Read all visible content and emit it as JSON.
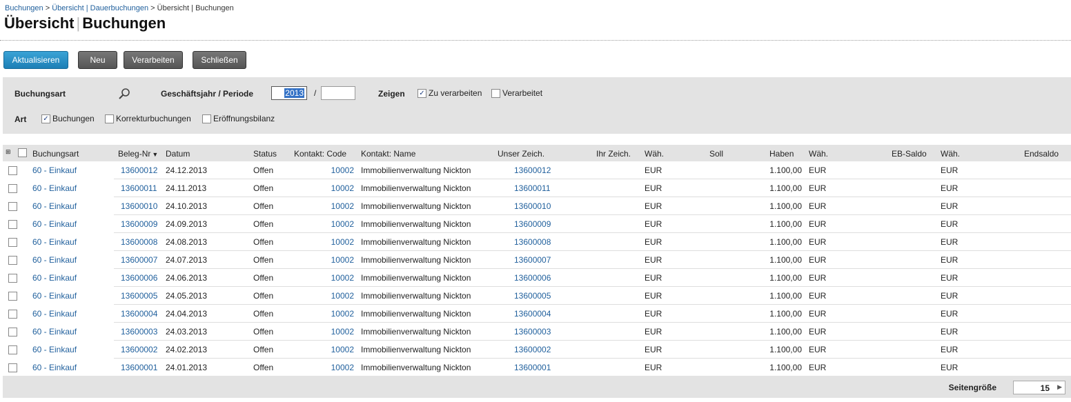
{
  "breadcrumb": {
    "items": [
      "Buchungen",
      "Übersicht | Dauerbuchungen",
      "Übersicht | Buchungen"
    ],
    "sep": ">"
  },
  "page": {
    "title_a": "Übersicht",
    "title_b": "Buchungen"
  },
  "toolbar": {
    "refresh": "Aktualisieren",
    "new": "Neu",
    "process": "Verarbeiten",
    "close": "Schließen"
  },
  "filter": {
    "booking_type_label": "Buchungsart",
    "fiscal_label": "Geschäftsjahr / Periode",
    "year_value": "2013",
    "period_value": "",
    "slash": "/",
    "show_label": "Zeigen",
    "to_process_label": "Zu verarbeiten",
    "to_process_checked": true,
    "processed_label": "Verarbeitet",
    "processed_checked": false,
    "art_label": "Art",
    "bookings_label": "Buchungen",
    "bookings_checked": true,
    "corrections_label": "Korrekturbuchungen",
    "corrections_checked": false,
    "opening_label": "Eröffnungsbilanz",
    "opening_checked": false
  },
  "grid": {
    "columns": {
      "type": "Buchungsart",
      "number": "Beleg-Nr",
      "date": "Datum",
      "status": "Status",
      "contact_code": "Kontakt: Code",
      "contact_name": "Kontakt: Name",
      "our_ref": "Unser Zeich.",
      "their_ref": "Ihr Zeich.",
      "currency1": "Wäh.",
      "debit": "Soll",
      "credit": "Haben",
      "currency2": "Wäh.",
      "eb_balance": "EB-Saldo",
      "currency3": "Wäh.",
      "end_balance": "Endsaldo"
    },
    "rows": [
      {
        "type": "60 - Einkauf",
        "number": "13600012",
        "date": "24.12.2013",
        "status": "Offen",
        "code": "10002",
        "name": "Immobilienverwaltung Nickton",
        "our_ref": "13600012",
        "their_ref": "",
        "cur1": "EUR",
        "debit": "",
        "credit": "1.100,00",
        "cur2": "EUR",
        "eb": "",
        "cur3": "EUR",
        "end": ""
      },
      {
        "type": "60 - Einkauf",
        "number": "13600011",
        "date": "24.11.2013",
        "status": "Offen",
        "code": "10002",
        "name": "Immobilienverwaltung Nickton",
        "our_ref": "13600011",
        "their_ref": "",
        "cur1": "EUR",
        "debit": "",
        "credit": "1.100,00",
        "cur2": "EUR",
        "eb": "",
        "cur3": "EUR",
        "end": ""
      },
      {
        "type": "60 - Einkauf",
        "number": "13600010",
        "date": "24.10.2013",
        "status": "Offen",
        "code": "10002",
        "name": "Immobilienverwaltung Nickton",
        "our_ref": "13600010",
        "their_ref": "",
        "cur1": "EUR",
        "debit": "",
        "credit": "1.100,00",
        "cur2": "EUR",
        "eb": "",
        "cur3": "EUR",
        "end": ""
      },
      {
        "type": "60 - Einkauf",
        "number": "13600009",
        "date": "24.09.2013",
        "status": "Offen",
        "code": "10002",
        "name": "Immobilienverwaltung Nickton",
        "our_ref": "13600009",
        "their_ref": "",
        "cur1": "EUR",
        "debit": "",
        "credit": "1.100,00",
        "cur2": "EUR",
        "eb": "",
        "cur3": "EUR",
        "end": ""
      },
      {
        "type": "60 - Einkauf",
        "number": "13600008",
        "date": "24.08.2013",
        "status": "Offen",
        "code": "10002",
        "name": "Immobilienverwaltung Nickton",
        "our_ref": "13600008",
        "their_ref": "",
        "cur1": "EUR",
        "debit": "",
        "credit": "1.100,00",
        "cur2": "EUR",
        "eb": "",
        "cur3": "EUR",
        "end": ""
      },
      {
        "type": "60 - Einkauf",
        "number": "13600007",
        "date": "24.07.2013",
        "status": "Offen",
        "code": "10002",
        "name": "Immobilienverwaltung Nickton",
        "our_ref": "13600007",
        "their_ref": "",
        "cur1": "EUR",
        "debit": "",
        "credit": "1.100,00",
        "cur2": "EUR",
        "eb": "",
        "cur3": "EUR",
        "end": ""
      },
      {
        "type": "60 - Einkauf",
        "number": "13600006",
        "date": "24.06.2013",
        "status": "Offen",
        "code": "10002",
        "name": "Immobilienverwaltung Nickton",
        "our_ref": "13600006",
        "their_ref": "",
        "cur1": "EUR",
        "debit": "",
        "credit": "1.100,00",
        "cur2": "EUR",
        "eb": "",
        "cur3": "EUR",
        "end": ""
      },
      {
        "type": "60 - Einkauf",
        "number": "13600005",
        "date": "24.05.2013",
        "status": "Offen",
        "code": "10002",
        "name": "Immobilienverwaltung Nickton",
        "our_ref": "13600005",
        "their_ref": "",
        "cur1": "EUR",
        "debit": "",
        "credit": "1.100,00",
        "cur2": "EUR",
        "eb": "",
        "cur3": "EUR",
        "end": ""
      },
      {
        "type": "60 - Einkauf",
        "number": "13600004",
        "date": "24.04.2013",
        "status": "Offen",
        "code": "10002",
        "name": "Immobilienverwaltung Nickton",
        "our_ref": "13600004",
        "their_ref": "",
        "cur1": "EUR",
        "debit": "",
        "credit": "1.100,00",
        "cur2": "EUR",
        "eb": "",
        "cur3": "EUR",
        "end": ""
      },
      {
        "type": "60 - Einkauf",
        "number": "13600003",
        "date": "24.03.2013",
        "status": "Offen",
        "code": "10002",
        "name": "Immobilienverwaltung Nickton",
        "our_ref": "13600003",
        "their_ref": "",
        "cur1": "EUR",
        "debit": "",
        "credit": "1.100,00",
        "cur2": "EUR",
        "eb": "",
        "cur3": "EUR",
        "end": ""
      },
      {
        "type": "60 - Einkauf",
        "number": "13600002",
        "date": "24.02.2013",
        "status": "Offen",
        "code": "10002",
        "name": "Immobilienverwaltung Nickton",
        "our_ref": "13600002",
        "their_ref": "",
        "cur1": "EUR",
        "debit": "",
        "credit": "1.100,00",
        "cur2": "EUR",
        "eb": "",
        "cur3": "EUR",
        "end": ""
      },
      {
        "type": "60 - Einkauf",
        "number": "13600001",
        "date": "24.01.2013",
        "status": "Offen",
        "code": "10002",
        "name": "Immobilienverwaltung Nickton",
        "our_ref": "13600001",
        "their_ref": "",
        "cur1": "EUR",
        "debit": "",
        "credit": "1.100,00",
        "cur2": "EUR",
        "eb": "",
        "cur3": "EUR",
        "end": ""
      }
    ]
  },
  "pager": {
    "label": "Seitengröße",
    "value": "15"
  }
}
